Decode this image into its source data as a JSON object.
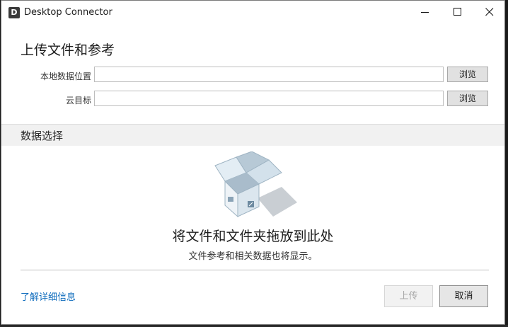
{
  "window": {
    "title": "Desktop Connector",
    "app_icon_letter": "D"
  },
  "upload_form": {
    "heading": "上传文件和参考",
    "local_location_label": "本地数据位置",
    "local_location_value": "",
    "cloud_target_label": "云目标",
    "cloud_target_value": "",
    "browse_label": "浏览"
  },
  "data_selection": {
    "section_title": "数据选择",
    "drop_title": "将文件和文件夹拖放到此处",
    "drop_subtitle": "文件参考和相关数据也将显示。",
    "illustration_icon": "open-box-icon"
  },
  "footer": {
    "learn_more": "了解详细信息",
    "upload_label": "上传",
    "cancel_label": "取消"
  },
  "colors": {
    "link": "#0f6cbd",
    "section_band": "#f1f1f1",
    "disabled_text": "#a6a6a6"
  }
}
